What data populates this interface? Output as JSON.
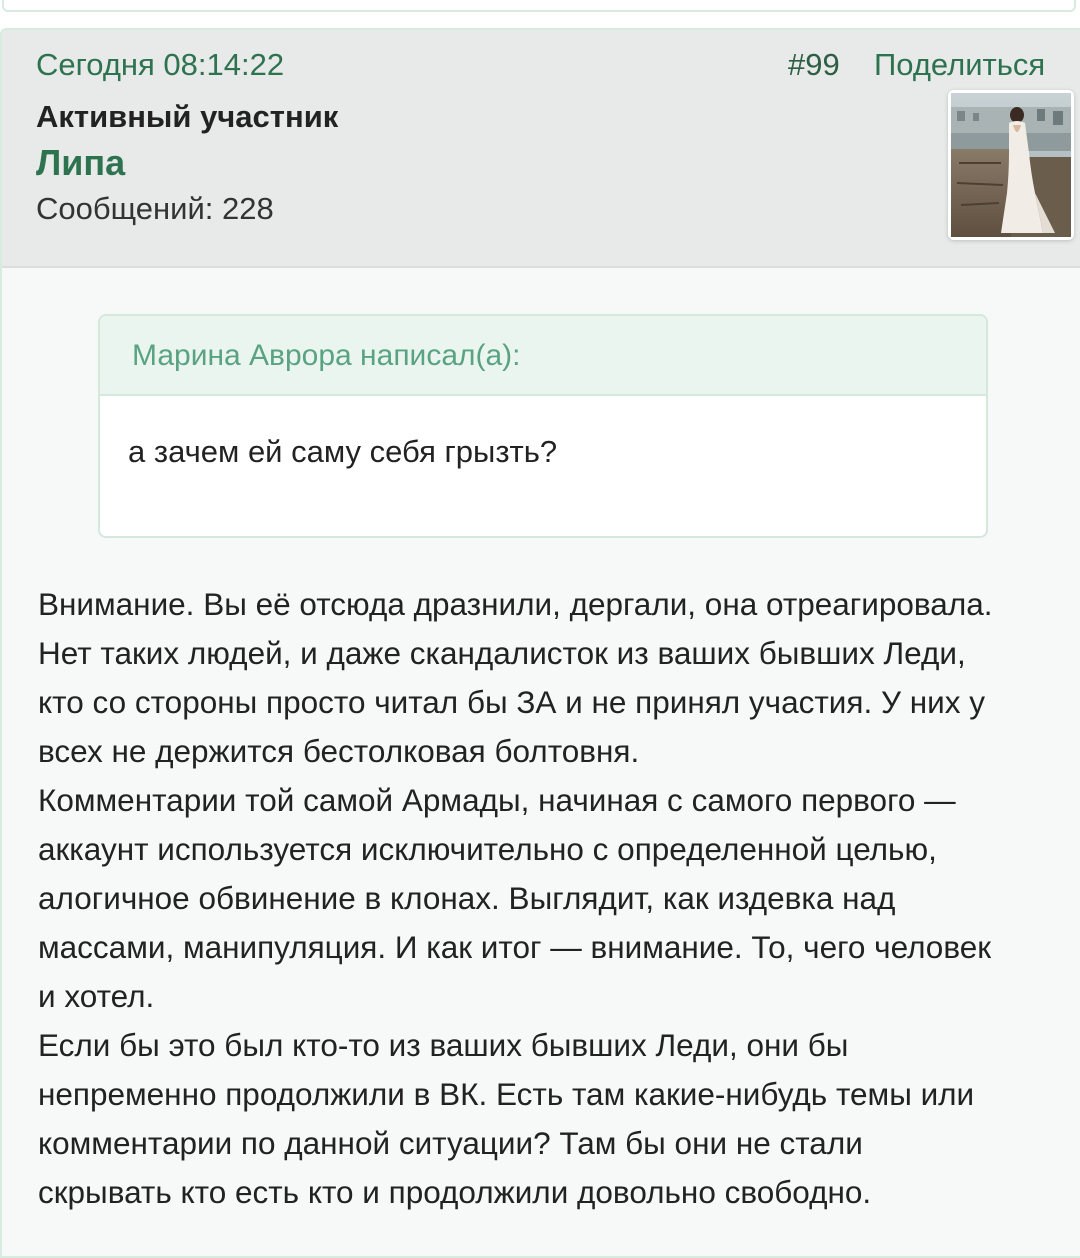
{
  "post": {
    "date": "Сегодня 08:14:22",
    "number": "#99",
    "share_label": "Поделиться",
    "user_title": "Активный участник",
    "username": "Липа",
    "messages": "Сообщений: 228"
  },
  "quote": {
    "author": "Марина Аврора написал(а):",
    "text": "а зачем ей саму себя грызть?"
  },
  "body": {
    "lines": [
      "Внимание. Вы её отсюда дразнили, дергали, она отреагировала.",
      "Нет таких людей, и даже скандалисток из ваших бывших Леди,",
      "кто  со стороны просто читал бы ЗА и не принял участия. У них у",
      "всех не держится бестолковая болтовня.",
      "Комментарии той самой Армады, начиная с самого первого —",
      "аккаунт используется исключительно с определенной целью,",
      "алогичное обвинение в клонах. Выглядит, как издевка над",
      "массами, манипуляция. И как итог — внимание. То, чего человек",
      "и хотел.",
      "Если бы это был кто-то из ваших бывших Леди, они бы",
      "непременно продолжили в ВК. Есть там какие-нибудь темы или",
      "комментарии по данной ситуации? Там бы они не стали",
      "скрывать кто есть кто и продолжили довольно свободно."
    ]
  },
  "colors": {
    "accent": "#2e7350",
    "quote_author": "#5aa382",
    "header_bg": "#e8e9e9",
    "border": "#d8ebdf"
  },
  "icons": {
    "avatar": "user-avatar-photo"
  }
}
